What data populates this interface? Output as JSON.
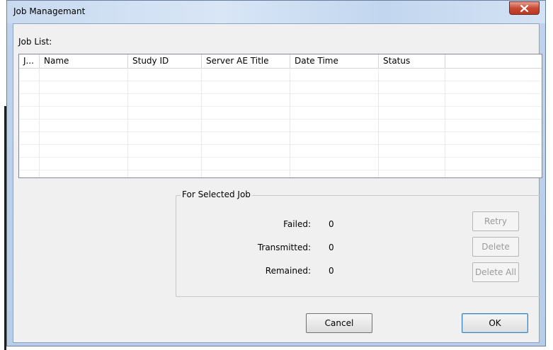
{
  "window": {
    "title": "Job Managemant"
  },
  "job_list": {
    "label": "Job List:",
    "columns": [
      "J...",
      "Name",
      "Study ID",
      "Server AE Title",
      "Date Time",
      "Status"
    ]
  },
  "selected_job": {
    "group_title": "For Selected Job",
    "failed_label": "Failed:",
    "failed_value": "0",
    "transmitted_label": "Transmitted:",
    "transmitted_value": "0",
    "remained_label": "Remained:",
    "remained_value": "0",
    "retry_label": "Retry",
    "delete_label": "Delete",
    "delete_all_label": "Delete All"
  },
  "footer": {
    "cancel_label": "Cancel",
    "ok_label": "OK"
  }
}
